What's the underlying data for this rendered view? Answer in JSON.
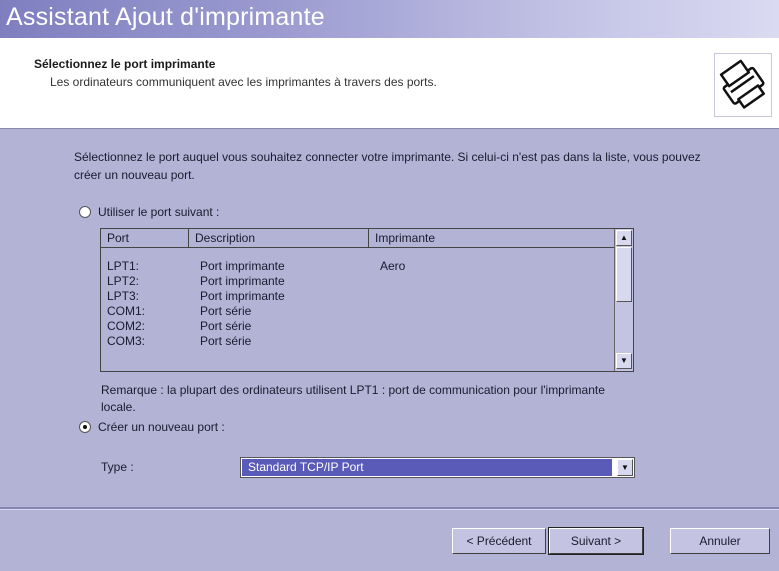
{
  "window": {
    "title": "Assistant Ajout d'imprimante"
  },
  "header": {
    "title": "Sélectionnez le port imprimante",
    "subtitle": "Les ordinateurs communiquent avec les imprimantes à travers des ports.",
    "icon": "printer-icon"
  },
  "body": {
    "description": "Sélectionnez le port auquel vous souhaitez connecter votre imprimante. Si celui-ci n'est pas dans la liste, vous pouvez créer un nouveau port.",
    "use_port_option": {
      "label": "Utiliser le port suivant :",
      "selected": false
    },
    "port_list": {
      "columns": [
        "Port",
        "Description",
        "Imprimante"
      ],
      "rows": [
        {
          "port": "LPT1:",
          "description": "Port imprimante",
          "printer": "Aero"
        },
        {
          "port": "LPT2:",
          "description": "Port imprimante",
          "printer": ""
        },
        {
          "port": "LPT3:",
          "description": "Port imprimante",
          "printer": ""
        },
        {
          "port": "COM1:",
          "description": "Port série",
          "printer": ""
        },
        {
          "port": "COM2:",
          "description": "Port série",
          "printer": ""
        },
        {
          "port": "COM3:",
          "description": "Port série",
          "printer": ""
        }
      ]
    },
    "remark": "Remarque : la plupart des ordinateurs utilisent LPT1 : port de communication pour l'imprimante locale.",
    "create_port_option": {
      "label": "Créer un nouveau port :",
      "selected": true
    },
    "type_label": "Type :",
    "type_value": "Standard TCP/IP Port"
  },
  "footer": {
    "back_label": "< Précédent",
    "next_label": "Suivant >",
    "cancel_label": "Annuler"
  },
  "colors": {
    "background": "#b3b3d6",
    "titlebar_start": "#7f7fc0",
    "selection": "#5a5ab8"
  }
}
